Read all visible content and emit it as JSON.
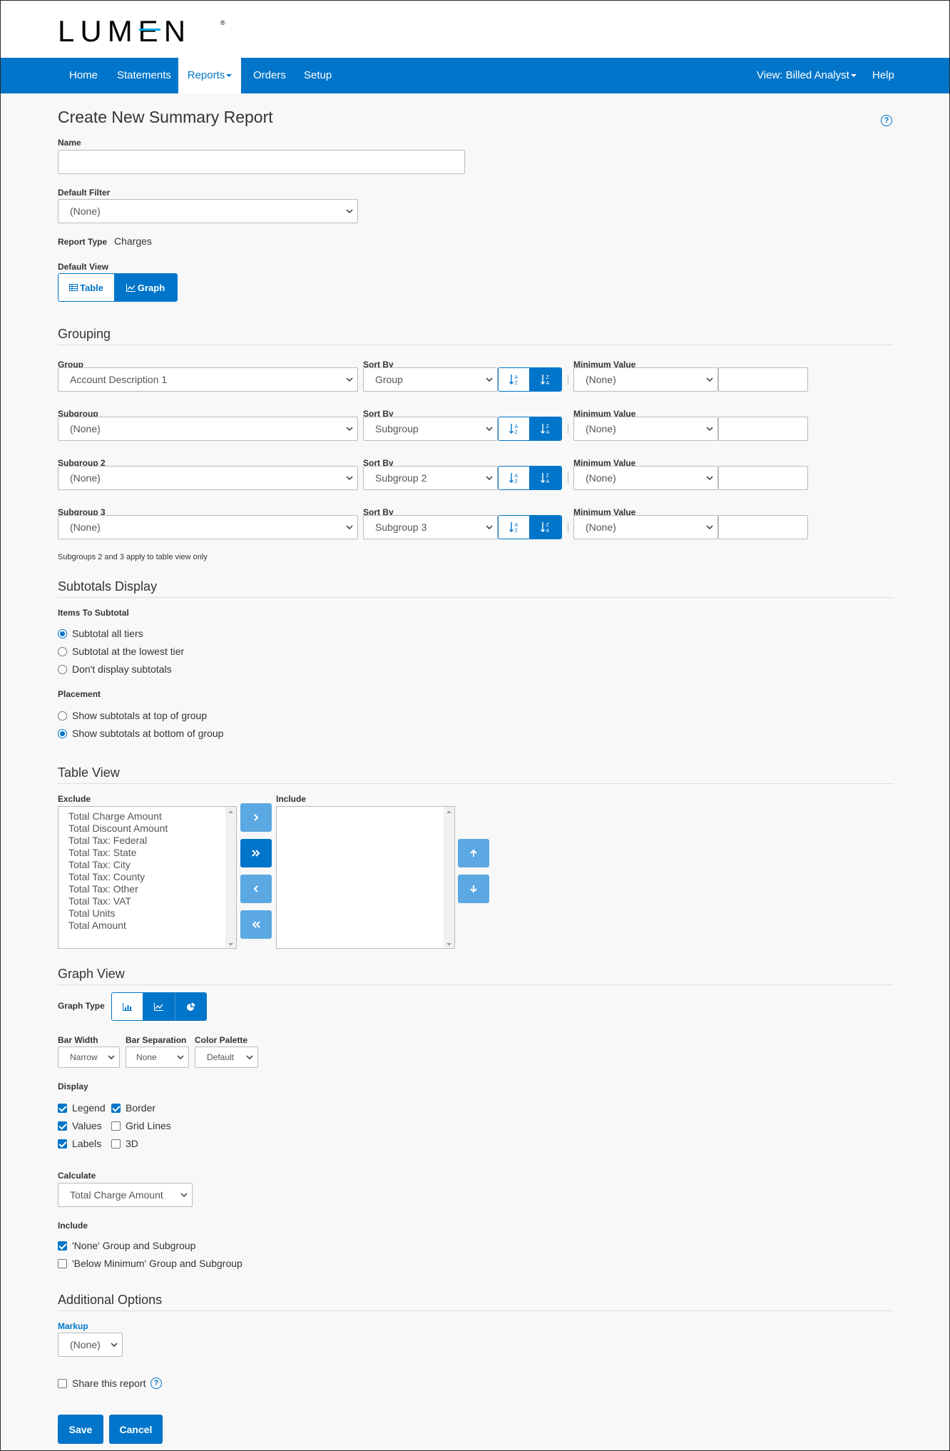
{
  "logo": {
    "text": "LUMEN",
    "mark": "®"
  },
  "nav": {
    "home": "Home",
    "statements": "Statements",
    "reports": "Reports",
    "orders": "Orders",
    "setup": "Setup",
    "view": "View: Billed Analyst",
    "help": "Help"
  },
  "page_title": "Create New Summary Report",
  "form": {
    "name_label": "Name",
    "name_value": "",
    "default_filter_label": "Default Filter",
    "default_filter_value": "(None)",
    "report_type_label": "Report Type",
    "report_type_value": "Charges",
    "default_view_label": "Default View",
    "view_table": "Table",
    "view_graph": "Graph"
  },
  "grouping": {
    "title": "Grouping",
    "rows": [
      {
        "group_label": "Group",
        "group_value": "Account Description 1",
        "sort_label": "Sort By",
        "sort_value": "Group",
        "min_label": "Minimum Value",
        "min_value": "(None)",
        "min_input": ""
      },
      {
        "group_label": "Subgroup",
        "group_value": "(None)",
        "sort_label": "Sort By",
        "sort_value": "Subgroup",
        "min_label": "Minimum Value",
        "min_value": "(None)",
        "min_input": ""
      },
      {
        "group_label": "Subgroup 2",
        "group_value": "(None)",
        "sort_label": "Sort By",
        "sort_value": "Subgroup 2",
        "min_label": "Minimum Value",
        "min_value": "(None)",
        "min_input": ""
      },
      {
        "group_label": "Subgroup 3",
        "group_value": "(None)",
        "sort_label": "Sort By",
        "sort_value": "Subgroup 3",
        "min_label": "Minimum Value",
        "min_value": "(None)",
        "min_input": ""
      }
    ],
    "note": "Subgroups 2 and 3 apply to table view only"
  },
  "subtotals": {
    "title": "Subtotals Display",
    "items_label": "Items To Subtotal",
    "items": [
      "Subtotal all tiers",
      "Subtotal at the lowest tier",
      "Don't display subtotals"
    ],
    "items_selected": 0,
    "placement_label": "Placement",
    "placement": [
      "Show subtotals at top of group",
      "Show subtotals at bottom of group"
    ],
    "placement_selected": 1
  },
  "table_view": {
    "title": "Table View",
    "exclude_label": "Exclude",
    "include_label": "Include",
    "exclude_items": [
      "Total Charge Amount",
      "Total Discount Amount",
      "Total Tax: Federal",
      "Total Tax: State",
      "Total Tax: City",
      "Total Tax: County",
      "Total Tax: Other",
      "Total Tax: VAT",
      "Total Units",
      "Total Amount"
    ],
    "include_items": []
  },
  "graph_view": {
    "title": "Graph View",
    "graph_type_label": "Graph Type",
    "graph_types": [
      "bar-chart-icon",
      "line-chart-icon",
      "pie-chart-icon"
    ],
    "bar_width_label": "Bar Width",
    "bar_width_value": "Narrow",
    "bar_sep_label": "Bar Separation",
    "bar_sep_value": "None",
    "palette_label": "Color Palette",
    "palette_value": "Default",
    "display_label": "Display",
    "display": {
      "legend": {
        "label": "Legend",
        "checked": true
      },
      "border": {
        "label": "Border",
        "checked": true
      },
      "values": {
        "label": "Values",
        "checked": true
      },
      "grid": {
        "label": "Grid Lines",
        "checked": false
      },
      "labels": {
        "label": "Labels",
        "checked": true
      },
      "three_d": {
        "label": "3D",
        "checked": false
      }
    },
    "calculate_label": "Calculate",
    "calculate_value": "Total Charge Amount",
    "include_label": "Include",
    "include_none": {
      "label": "'None' Group and Subgroup",
      "checked": true
    },
    "include_below": {
      "label": "'Below Minimum' Group and Subgroup",
      "checked": false
    }
  },
  "additional": {
    "title": "Additional Options",
    "markup_label": "Markup",
    "markup_value": "(None)",
    "share_label": "Share this report",
    "share_checked": false
  },
  "actions": {
    "save": "Save",
    "cancel": "Cancel"
  },
  "colors": {
    "primary": "#0075c9",
    "light_button": "#5ba8e2",
    "background": "#f8f8f8"
  }
}
